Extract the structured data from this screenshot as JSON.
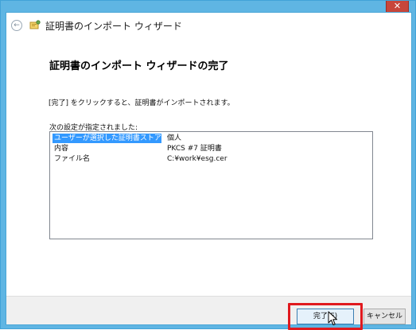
{
  "window": {
    "close_glyph": "✕"
  },
  "nav": {
    "back_glyph": "←",
    "title": "証明書のインポート ウィザード"
  },
  "page": {
    "heading": "証明書のインポート ウィザードの完了",
    "description": "[完了] をクリックすると、証明書がインポートされます。",
    "list_label": "次の設定が指定されました:"
  },
  "settings": [
    {
      "name": "ユーザーが選択した証明書ストア",
      "value": "個人",
      "selected": true
    },
    {
      "name": "内容",
      "value": "PKCS #7 証明書",
      "selected": false
    },
    {
      "name": "ファイル名",
      "value": "C:¥work¥esg.cer",
      "selected": false
    }
  ],
  "footer": {
    "finish_label": "完了(F)",
    "cancel_label": "キャンセル"
  },
  "colors": {
    "title_bar": "#5fb5e3",
    "close_button": "#c7463b",
    "selection": "#3399ff",
    "highlight_box": "#e0191e"
  }
}
